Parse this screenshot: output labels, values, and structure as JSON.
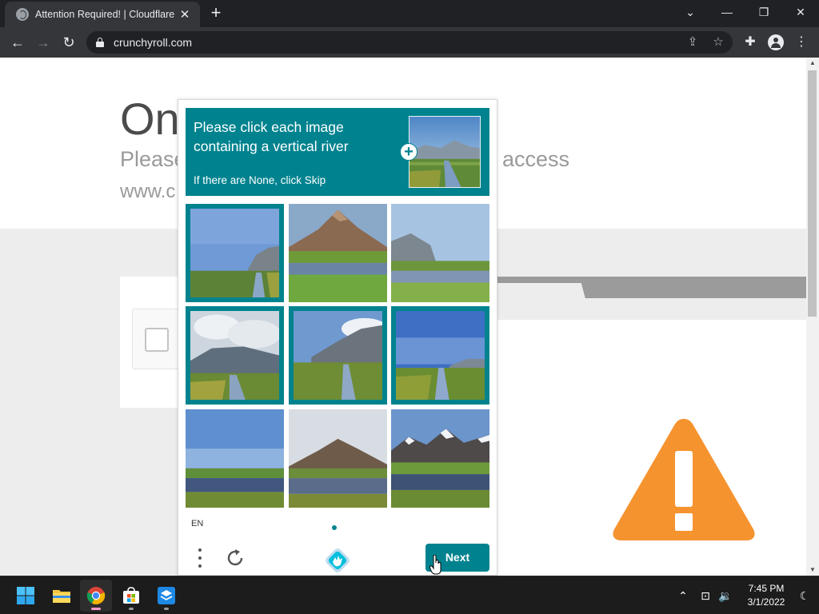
{
  "browser": {
    "tab_title": "Attention Required! | Cloudflare",
    "url": "crunchyroll.com"
  },
  "page": {
    "heading_partial": "On",
    "subtext_left_partial": "Please",
    "subtext_right_partial": "access",
    "url_partial": "www.c"
  },
  "captcha": {
    "prompt": "Please click each image containing a vertical river",
    "skip_hint": "If there are None, click Skip",
    "language": "EN",
    "next_label": "Next",
    "tiles": [
      {
        "selected": true,
        "scene": "river-hill-right"
      },
      {
        "selected": false,
        "scene": "volcano-pond"
      },
      {
        "selected": false,
        "scene": "hills-pond"
      },
      {
        "selected": true,
        "scene": "clouds-river"
      },
      {
        "selected": true,
        "scene": "hills-river-clouds"
      },
      {
        "selected": true,
        "scene": "blue-sky-river"
      },
      {
        "selected": false,
        "scene": "flat-lake"
      },
      {
        "selected": false,
        "scene": "dark-volcano-lake"
      },
      {
        "selected": false,
        "scene": "snowy-mountains-lake"
      }
    ]
  },
  "taskbar": {
    "time": "7:45 PM",
    "date": "3/1/2022"
  },
  "colors": {
    "captcha_teal": "#00838f",
    "warning_orange": "#f5932f",
    "chrome_dark": "#202124",
    "chrome_toolbar": "#35363a"
  },
  "icons": [
    "globe-icon",
    "close-icon",
    "plus-icon",
    "chevron-down-icon",
    "minimize-icon",
    "restore-icon",
    "back-arrow-icon",
    "forward-arrow-icon",
    "reload-icon",
    "lock-icon",
    "share-icon",
    "star-icon",
    "puzzle-icon",
    "avatar-icon",
    "more-vert-icon",
    "warning-icon",
    "hcaptcha-logo-icon",
    "refresh-icon",
    "windows-start-icon",
    "file-explorer-icon",
    "chrome-icon",
    "store-icon",
    "app-icon",
    "chevron-up-icon",
    "network-icon",
    "volume-icon",
    "moon-icon"
  ]
}
